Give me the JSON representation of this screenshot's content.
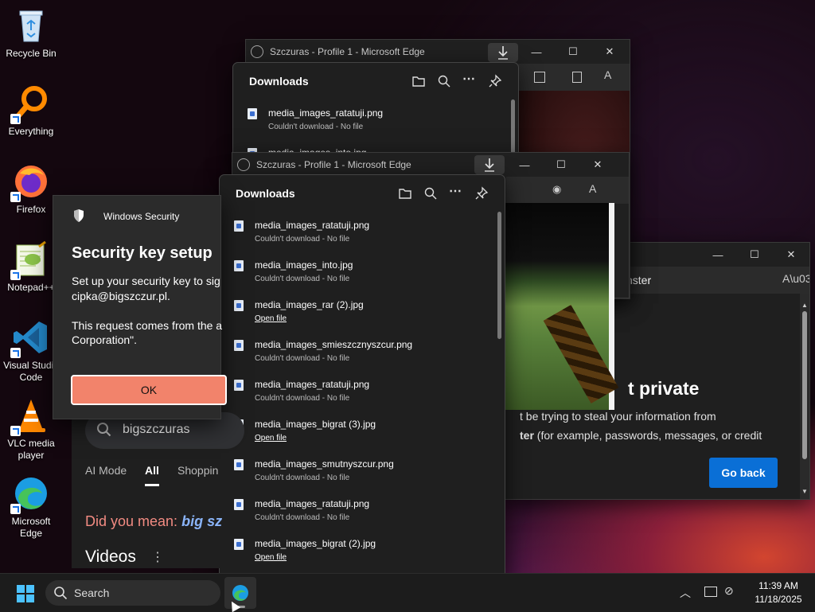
{
  "desktop": {
    "icons": [
      {
        "label": "Recycle Bin",
        "icon": "recycle-bin-icon"
      },
      {
        "label": "Everything",
        "icon": "everything-icon"
      },
      {
        "label": "Firefox",
        "icon": "firefox-icon"
      },
      {
        "label": "Notepad++",
        "icon": "notepad-plus-plus-icon"
      },
      {
        "label": "Visual Studio Code",
        "icon": "vscode-icon"
      },
      {
        "label": "VLC media player",
        "icon": "vlc-icon"
      },
      {
        "label": "Microsoft Edge",
        "icon": "edge-icon"
      }
    ]
  },
  "edge_back": {
    "title": "Szczuras - Profile 1 - Microsoft Edge",
    "downloads": {
      "title": "Downloads",
      "items": [
        {
          "name": "media_images_ratatuji.png",
          "status": "Couldn't download - No file"
        },
        {
          "name": "media_images_into.jpg",
          "status": ""
        }
      ]
    }
  },
  "edge_front": {
    "title": "Szczuras - Profile 1 - Microsoft Edge",
    "downloads": {
      "title": "Downloads",
      "items": [
        {
          "name": "media_images_ratatuji.png",
          "status": "Couldn't download - No file",
          "link": false
        },
        {
          "name": "media_images_into.jpg",
          "status": "Couldn't download - No file",
          "link": false
        },
        {
          "name": "media_images_rar (2).jpg",
          "status": "Open file",
          "link": true
        },
        {
          "name": "media_images_smieszcznyszcur.png",
          "status": "Couldn't download - No file",
          "link": false
        },
        {
          "name": "media_images_ratatuji.png",
          "status": "Couldn't download - No file",
          "link": false
        },
        {
          "name": "media_images_bigrat (3).jpg",
          "status": "Open file",
          "link": true
        },
        {
          "name": "media_images_smutnyszcur.png",
          "status": "Couldn't download - No file",
          "link": false
        },
        {
          "name": "media_images_ratatuji.png",
          "status": "Couldn't download - No file",
          "link": false
        },
        {
          "name": "media_images_bigrat (2).jpg",
          "status": "Open file",
          "link": true
        }
      ]
    }
  },
  "security": {
    "header": "Windows Security",
    "title": "Security key setup",
    "line1": "Set up your security key to sig",
    "line2": "cipka@bigszczur.pl.",
    "line3": "This request comes from the a",
    "line4": "Corporation\".",
    "ok": "OK"
  },
  "search_page": {
    "query": "bigszczuras",
    "tabs": [
      "AI Mode",
      "All",
      "Shoppin"
    ],
    "did_you_mean": "Did you mean:",
    "suggestion": "big sz",
    "videos": "Videos"
  },
  "warning": {
    "url_fragment": "nster",
    "heading": "t private",
    "line1": "t be trying to steal your information from",
    "line2_bold": "ter",
    "line2": " (for example, passwords, messages, or credit",
    "go_back": "Go back"
  },
  "taskbar": {
    "search": "Search",
    "time": "11:39 AM",
    "date": "11/18/2025"
  },
  "colors": {
    "accent_blue": "#0a6fd6",
    "ok_button": "#f2836b",
    "did_you_mean": "#f28b82",
    "suggestion": "#8ab4f8"
  }
}
